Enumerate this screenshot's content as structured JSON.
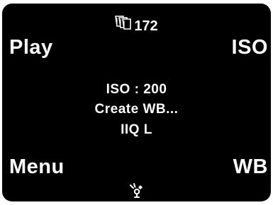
{
  "status": {
    "frames_icon": "stacked-frames-icon",
    "frames_remaining": "172",
    "connection_icon": "firewire-icon"
  },
  "softkeys": {
    "top_left": "Play",
    "top_right": "ISO",
    "bottom_left": "Menu",
    "bottom_right": "WB"
  },
  "info": {
    "iso": "ISO : 200",
    "wb": "Create WB...",
    "format": "IIQ L"
  },
  "colors": {
    "screen_background": "#000000",
    "text": "#ffffff"
  }
}
